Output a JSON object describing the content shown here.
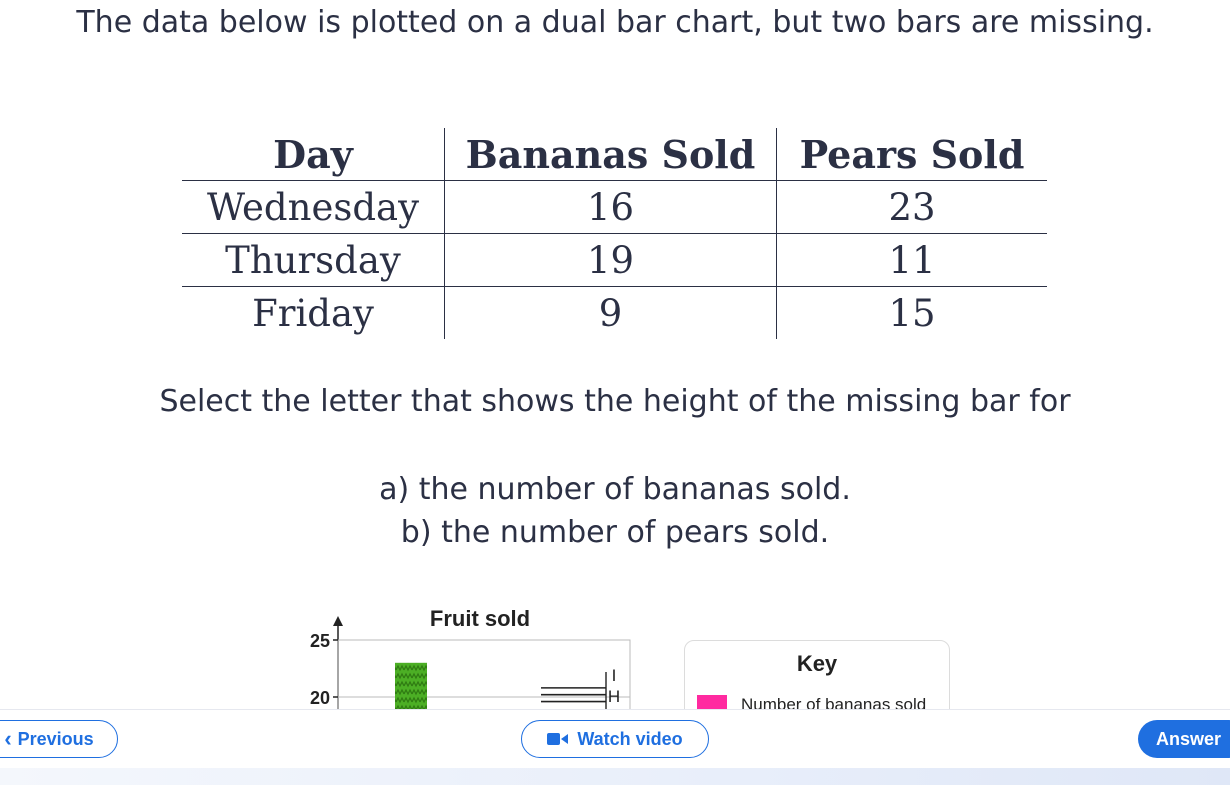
{
  "question": {
    "intro": "The data below is plotted on a dual bar chart, but two bars are missing.",
    "select": "Select the letter that shows the height of the missing bar for",
    "part_a": "a) the number of bananas sold.",
    "part_b": "b) the number of pears sold."
  },
  "table": {
    "headers": [
      "Day",
      "Bananas Sold",
      "Pears Sold"
    ],
    "rows": [
      [
        "Wednesday",
        "16",
        "23"
      ],
      [
        "Thursday",
        "19",
        "11"
      ],
      [
        "Friday",
        "9",
        "15"
      ]
    ]
  },
  "chart_data": {
    "type": "bar",
    "title": "Fruit sold",
    "y_ticks": [
      "25",
      "20"
    ],
    "ylim": [
      18,
      25
    ],
    "visible_bar": {
      "value": 23,
      "color": "#4caf25"
    },
    "option_lines": [
      {
        "value": 20.8
      },
      {
        "value": 20.2
      },
      {
        "value": 19.6
      }
    ],
    "option_labels": [
      "I",
      "H"
    ]
  },
  "key": {
    "title": "Key",
    "bananas_label": "Number of bananas sold",
    "bananas_color": "#ff2aa0"
  },
  "nav": {
    "previous": "Previous",
    "watch_video": "Watch video",
    "answer": "Answer",
    "accent": "#1f6fe0"
  }
}
